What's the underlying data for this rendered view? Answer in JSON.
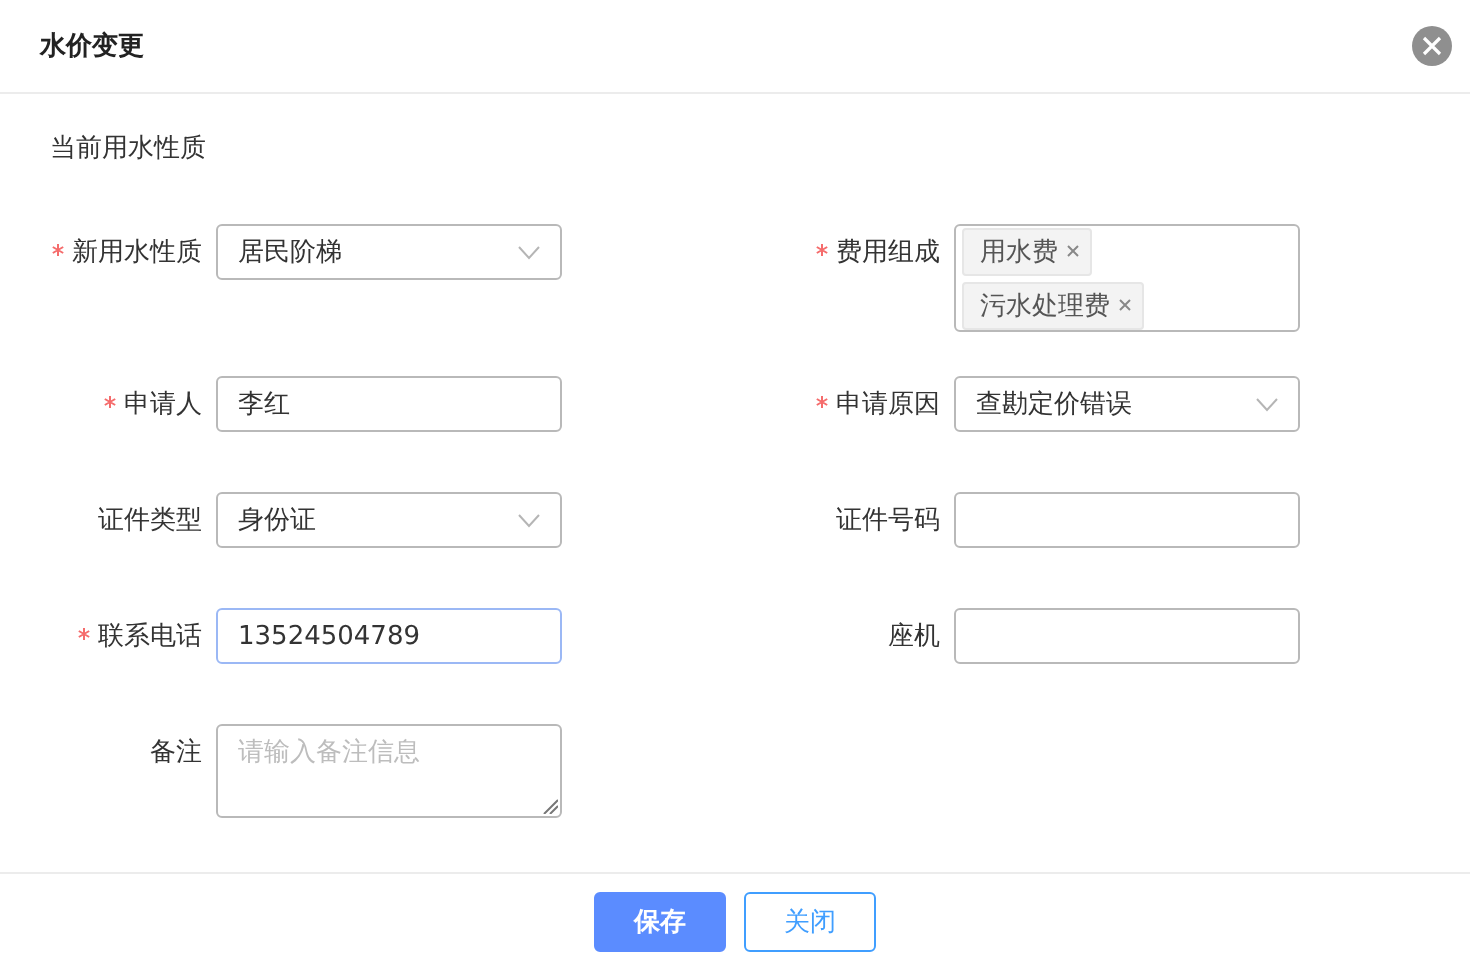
{
  "dialog": {
    "title": "水价变更",
    "section_label": "当前用水性质"
  },
  "rows": [
    [
      {
        "label": "新用水性质",
        "required": true,
        "kind": "select",
        "value": "居民阶梯",
        "focused": false
      },
      {
        "label": "费用组成",
        "required": true,
        "kind": "tags",
        "tags": [
          "用水费",
          "污水处理费"
        ],
        "focused": false
      }
    ],
    [
      {
        "label": "申请人",
        "required": true,
        "kind": "input",
        "value": "李红",
        "focused": false
      },
      {
        "label": "申请原因",
        "required": true,
        "kind": "select",
        "value": "查勘定价错误",
        "focused": false
      }
    ],
    [
      {
        "label": "证件类型",
        "required": false,
        "kind": "select",
        "value": "身份证",
        "focused": false
      },
      {
        "label": "证件号码",
        "required": false,
        "kind": "input",
        "focused": false
      }
    ],
    [
      {
        "label": "联系电话",
        "required": true,
        "kind": "input",
        "value": "13524504789",
        "focused": true
      },
      {
        "label": "座机",
        "required": false,
        "kind": "input",
        "focused": false
      }
    ],
    [
      {
        "label": "备注",
        "required": false,
        "kind": "textarea",
        "placeholder": "请输入备注信息",
        "focused": false
      }
    ]
  ],
  "buttons": [
    {
      "label": "保存",
      "kind": "primary"
    },
    {
      "label": "关闭",
      "kind": "secondary"
    }
  ]
}
